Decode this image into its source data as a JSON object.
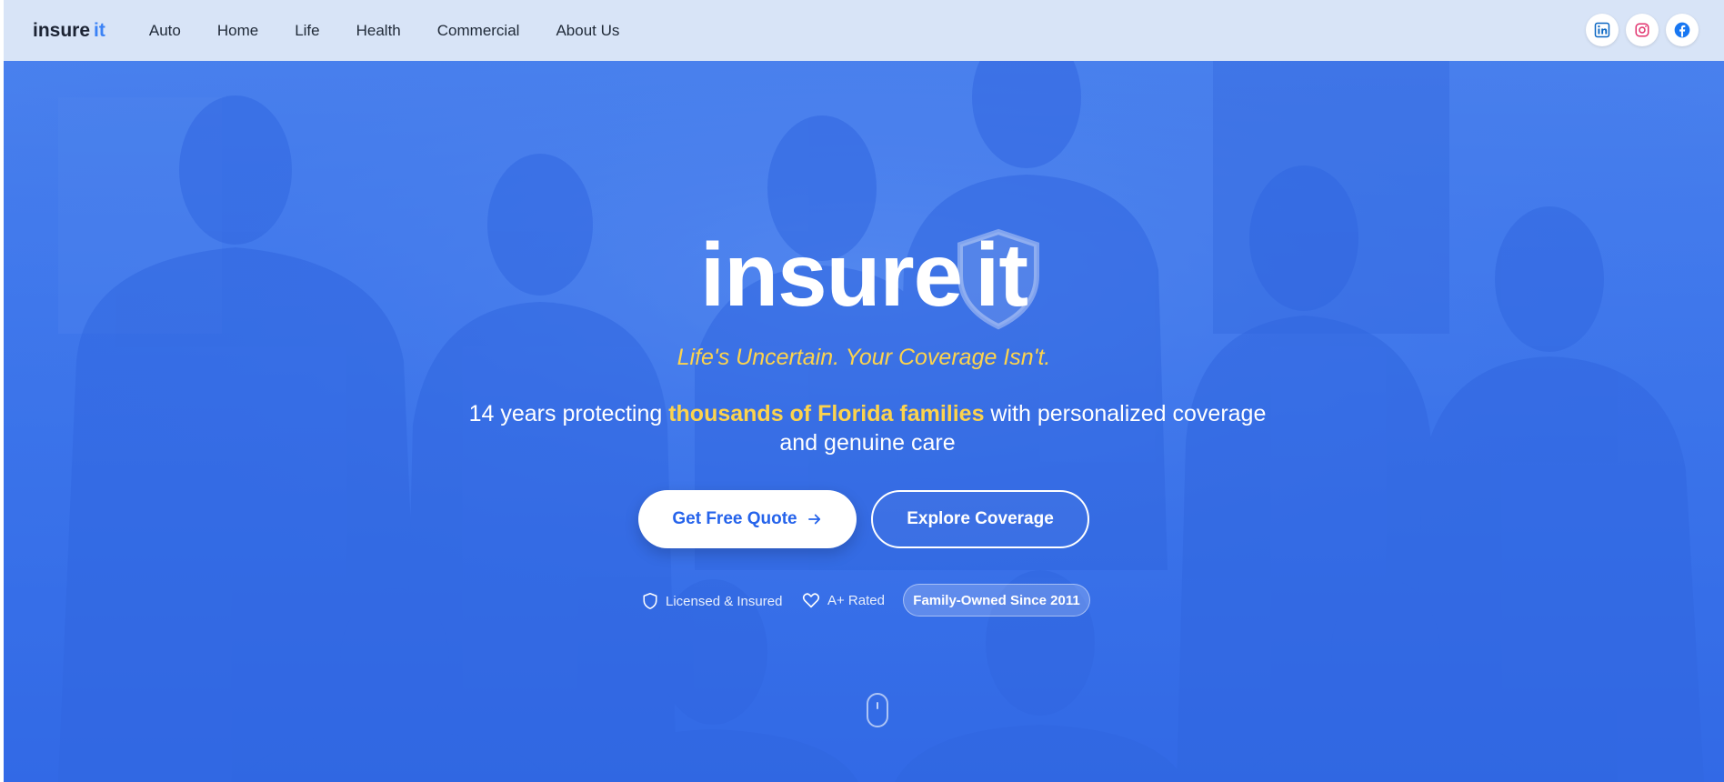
{
  "brand": {
    "name": "insure",
    "accent": "it",
    "accent_color": "#3b82f6"
  },
  "nav": {
    "items": [
      {
        "label": "Auto"
      },
      {
        "label": "Home"
      },
      {
        "label": "Life"
      },
      {
        "label": "Health"
      },
      {
        "label": "Commercial"
      },
      {
        "label": "About Us"
      }
    ],
    "socials": [
      {
        "icon": "linkedin-icon",
        "color": "#0a66c2"
      },
      {
        "icon": "instagram-icon",
        "color": "#e1306c"
      },
      {
        "icon": "facebook-icon",
        "color": "#1877f2"
      }
    ]
  },
  "hero": {
    "logo_main": "insure",
    "logo_accent": "it",
    "tagline": "Life's Uncertain. Your Coverage Isn't.",
    "subhead_before": "14 years protecting ",
    "subhead_highlight": "thousands of Florida families",
    "subhead_after": " with personalized coverage and genuine care",
    "primary_button": "Get Free Quote",
    "secondary_button": "Explore Coverage",
    "badges": [
      {
        "icon": "shield-icon",
        "label": "Licensed & Insured"
      },
      {
        "icon": "heart-icon",
        "label": "A+ Rated"
      }
    ],
    "pill": "Family-Owned Since 2011",
    "colors": {
      "hero_blue": "#3b74ea",
      "highlight_yellow": "#fcd34d",
      "button_text": "#2563eb"
    }
  }
}
